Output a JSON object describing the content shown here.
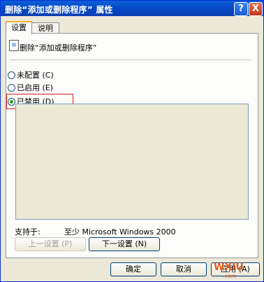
{
  "window": {
    "title": "删除“添加或删除程序” 属性",
    "help_glyph": "?",
    "close_glyph": "X"
  },
  "tabs": [
    {
      "label": "设置",
      "active": true
    },
    {
      "label": "说明",
      "active": false
    }
  ],
  "policy": {
    "icon": "policy-document-icon",
    "name": "删除“添加或删除程序”"
  },
  "options": [
    {
      "label": "未配置 (C)",
      "checked": false
    },
    {
      "label": "已启用 (E)",
      "checked": false
    },
    {
      "label": "已禁用 (D)",
      "checked": true
    }
  ],
  "support": {
    "label": "支持于:",
    "value": "至少 Microsoft Windows 2000"
  },
  "nav": {
    "prev_label": "上一设置 (P)",
    "next_label": "下一设置 (N)"
  },
  "footer": {
    "ok_label": "确定",
    "cancel_label": "取消",
    "apply_label": "应用 (A)"
  },
  "watermark": {
    "text": "WXIU",
    "suffix": ".com"
  },
  "colors": {
    "titlebar": "#0546c4",
    "highlight_border": "#d81b1b",
    "radio_checked": "#21a121"
  }
}
